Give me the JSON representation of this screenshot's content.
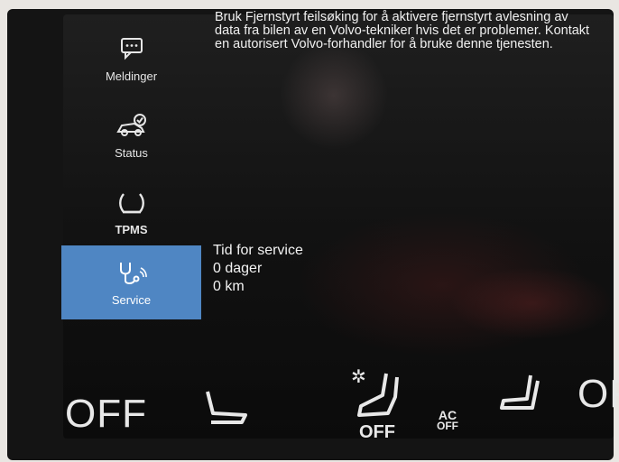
{
  "sidebar": {
    "items": [
      {
        "label": "Meldinger",
        "icon": "message-icon"
      },
      {
        "label": "Status",
        "icon": "car-check-icon"
      },
      {
        "label": "TPMS",
        "icon": "tire-pressure-icon"
      },
      {
        "label": "Service",
        "icon": "stethoscope-icon",
        "active": true
      }
    ]
  },
  "message": {
    "text": "Bruk Fjernstyrt feilsøking for å aktivere fjernstyrt avlesning av data fra bilen av en Volvo-tekniker hvis det er problemer. Kontakt en autorisert Volvo-forhandler for å bruke denne tjenesten."
  },
  "service": {
    "title": "Tid for service",
    "days": "0 dager",
    "distance": "0 km"
  },
  "climate": {
    "left_off": "OFF",
    "right_off": "OF",
    "center_off": "OFF",
    "ac_line1": "AC",
    "ac_line2": "OFF"
  },
  "colors": {
    "active_tab": "#4f86c3",
    "screen_bg": "#111111",
    "text": "#f0f0f0"
  }
}
